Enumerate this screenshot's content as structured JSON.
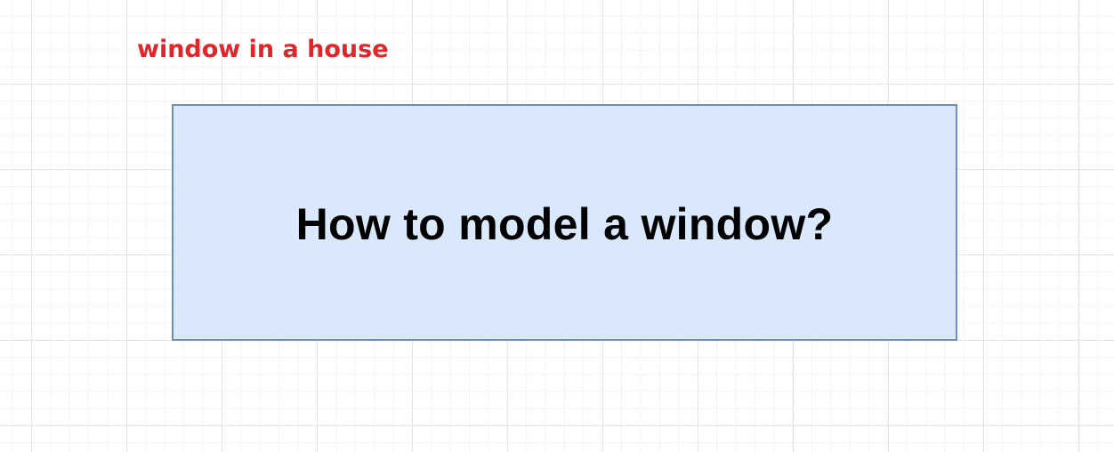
{
  "diagram": {
    "annotation": {
      "text": "window in a house",
      "color": "#e0262b"
    },
    "node": {
      "label": "How to model a window?",
      "fill_color": "#dae8fc",
      "stroke_color": "#6c8ebf",
      "text_color": "#000000"
    }
  }
}
